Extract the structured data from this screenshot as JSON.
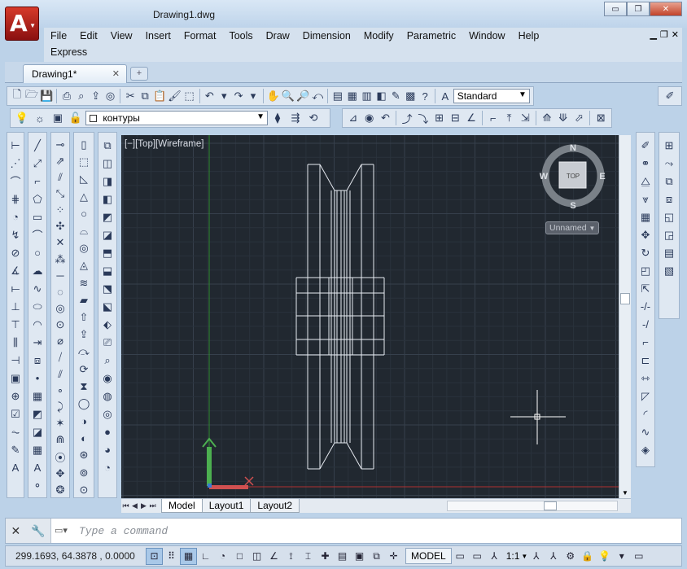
{
  "window": {
    "title": "Drawing1.dwg",
    "minimize": "▭",
    "restore": "❐",
    "close": "✕"
  },
  "menus": {
    "row1": [
      "File",
      "Edit",
      "View",
      "Insert",
      "Format",
      "Tools",
      "Draw",
      "Dimension",
      "Modify",
      "Parametric",
      "Window",
      "Help"
    ],
    "row2": [
      "Express"
    ]
  },
  "tabs": {
    "doc_tab": "Drawing1*",
    "close_glyph": "✕",
    "new_tab_glyph": "+"
  },
  "toolbar_top": {
    "text_style": "Standard"
  },
  "toolbar_layers": {
    "layer_name": "контуры"
  },
  "viewport": {
    "label": "[−][Top][Wireframe]",
    "viewcube": {
      "north": "N",
      "south": "S",
      "east": "E",
      "west": "W",
      "face": "TOP"
    },
    "ucs_label": "Unnamed",
    "colors": {
      "background": "#212830",
      "grid_minor": "#2a323c",
      "grid_major": "#36404c",
      "drawing": "#e8ecf2",
      "x_axis": "#b03030",
      "y_axis": "#2f8a2f"
    }
  },
  "layout_tabs": [
    "Model",
    "Layout1",
    "Layout2"
  ],
  "command_line": {
    "placeholder": "Type a command"
  },
  "status_bar": {
    "coordinates": "299.1693, 64.3878 , 0.0000",
    "model": "MODEL",
    "scale": "1:1"
  }
}
